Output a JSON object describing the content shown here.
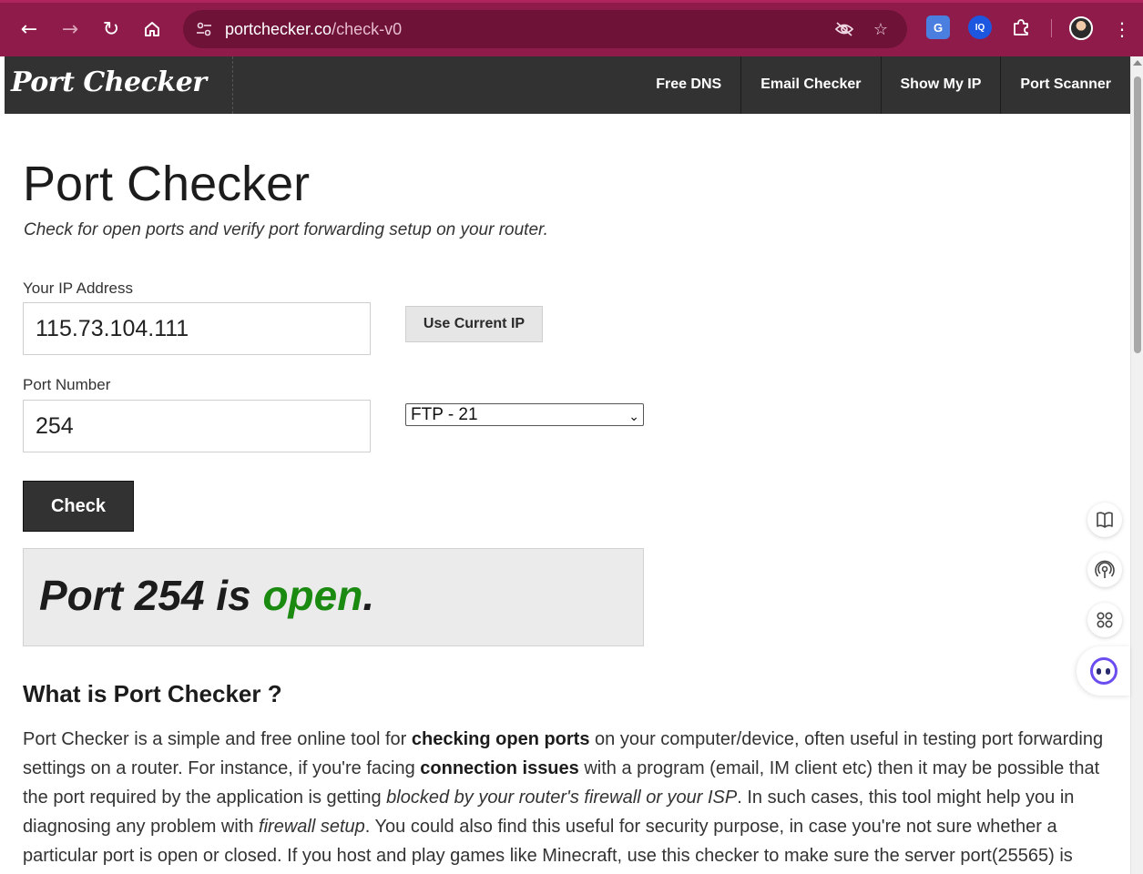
{
  "browser": {
    "url_host": "portchecker.co",
    "url_path": "/check-v0",
    "back_icon": "arrow-left-icon",
    "forward_icon": "arrow-right-icon",
    "reload_icon": "reload-icon",
    "home_icon": "home-icon",
    "site_info_icon": "tune-icon",
    "eye_icon": "eye-off-icon",
    "star_icon": "star-icon",
    "extensions": [
      "google-translate-icon",
      "iq-extension-icon",
      "puzzle-icon"
    ],
    "menu_icon": "kebab-menu-icon",
    "theme_color": "#8e1b4a"
  },
  "site": {
    "logo": "Port Checker",
    "nav": [
      {
        "label": "Free DNS"
      },
      {
        "label": "Email Checker"
      },
      {
        "label": "Show My IP"
      },
      {
        "label": "Port Scanner"
      }
    ]
  },
  "page": {
    "title": "Port Checker",
    "subtitle": "Check for open ports and verify port forwarding setup on your router.",
    "ip_label": "Your IP Address",
    "ip_value": "115.73.104.111",
    "use_current_ip": "Use Current IP",
    "port_label": "Port Number",
    "port_value": "254",
    "port_select": "FTP - 21",
    "check_button": "Check",
    "result": {
      "prefix": "Port 254 is ",
      "status": "open",
      "suffix": ".",
      "status_color": "#1a8a11"
    },
    "section_heading": "What is Port Checker ?",
    "paragraph": {
      "p1": "Port Checker is a simple and free online tool for ",
      "b1": "checking open ports",
      "p2": " on your computer/device, often useful in testing port forwarding settings on a router. For instance, if you're facing ",
      "b2": "connection issues",
      "p3": " with a program (email, IM client etc) then it may be possible that the port required by the application is getting ",
      "i1": "blocked by your router's firewall or your ISP",
      "p4": ". In such cases, this tool might help you in diagnosing any problem with ",
      "i2": "firewall setup",
      "p5": ". You could also find this useful for security purpose, in case you're not sure whether a particular port is open or closed. If you host and play games like Minecraft, use this checker to make sure the server port(25565) is"
    }
  },
  "side_tools": [
    "book-icon",
    "broadcast-icon",
    "apps-icon",
    "ai-assistant-icon"
  ]
}
